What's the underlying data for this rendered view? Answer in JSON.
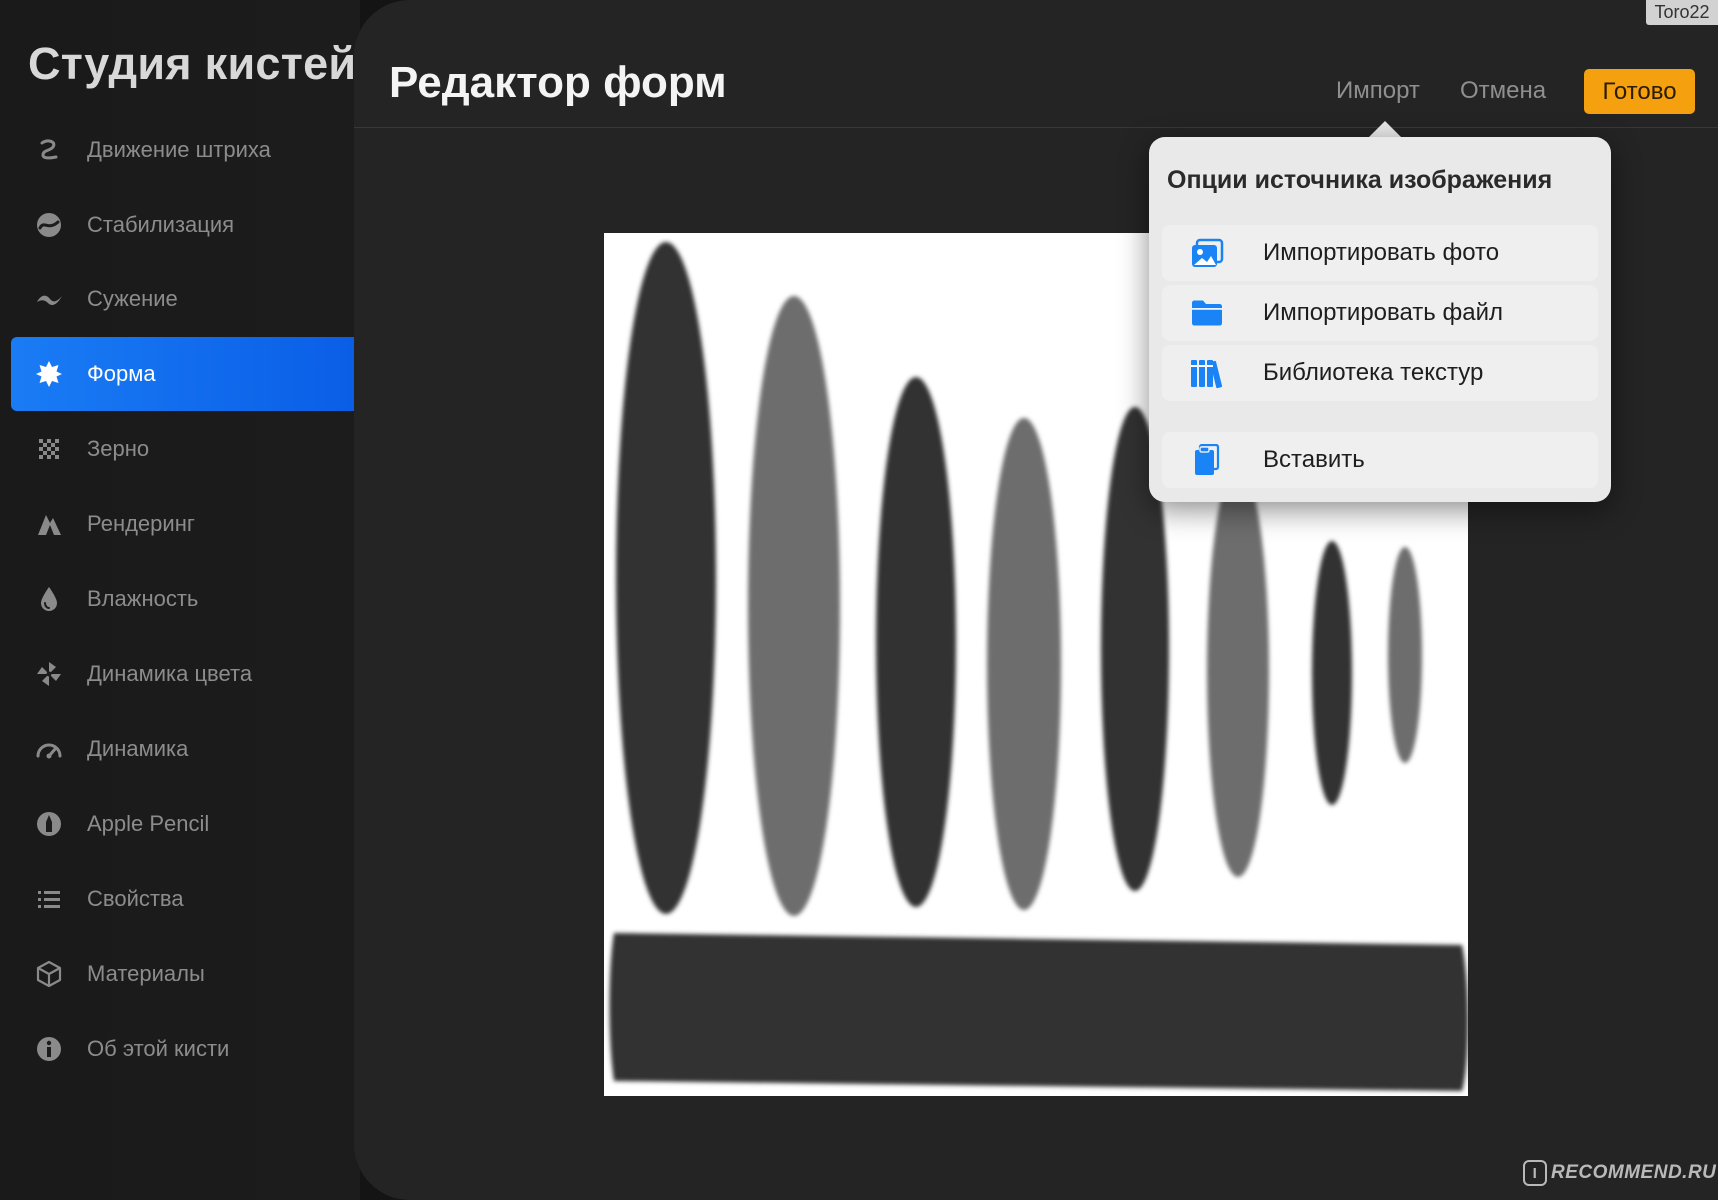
{
  "sidebar": {
    "title": "Студия кистей",
    "items": [
      {
        "label": "Движение штриха",
        "icon": "stroke-path-icon",
        "active": false
      },
      {
        "label": "Стабилизация",
        "icon": "stabilization-icon",
        "active": false
      },
      {
        "label": "Сужение",
        "icon": "taper-icon",
        "active": false
      },
      {
        "label": "Форма",
        "icon": "shape-icon",
        "active": true
      },
      {
        "label": "Зерно",
        "icon": "grain-icon",
        "active": false
      },
      {
        "label": "Рендеринг",
        "icon": "rendering-icon",
        "active": false
      },
      {
        "label": "Влажность",
        "icon": "wet-mix-icon",
        "active": false
      },
      {
        "label": "Динамика цвета",
        "icon": "color-dynamics-icon",
        "active": false
      },
      {
        "label": "Динамика",
        "icon": "dynamics-icon",
        "active": false
      },
      {
        "label": "Apple Pencil",
        "icon": "apple-pencil-icon",
        "active": false
      },
      {
        "label": "Свойства",
        "icon": "properties-icon",
        "active": false
      },
      {
        "label": "Материалы",
        "icon": "materials-icon",
        "active": false
      },
      {
        "label": "Об этой кисти",
        "icon": "info-icon",
        "active": false
      }
    ]
  },
  "header": {
    "title": "Редактор форм",
    "import_label": "Импорт",
    "cancel_label": "Отмена",
    "done_label": "Готово"
  },
  "popover": {
    "title": "Опции источника изображения",
    "items": [
      {
        "label": "Импортировать фото",
        "icon": "photo-icon"
      },
      {
        "label": "Импортировать файл",
        "icon": "folder-icon"
      },
      {
        "label": "Библиотека текстур",
        "icon": "library-icon"
      },
      {
        "label": "Вставить",
        "icon": "paste-icon"
      }
    ]
  },
  "colors": {
    "accent": "#0a6cf0",
    "done_button": "#f5a00f",
    "popover_icon": "#1a84f6"
  },
  "overlay": {
    "user_tag": "Toro22",
    "watermark": "RECOMMEND.RU"
  }
}
